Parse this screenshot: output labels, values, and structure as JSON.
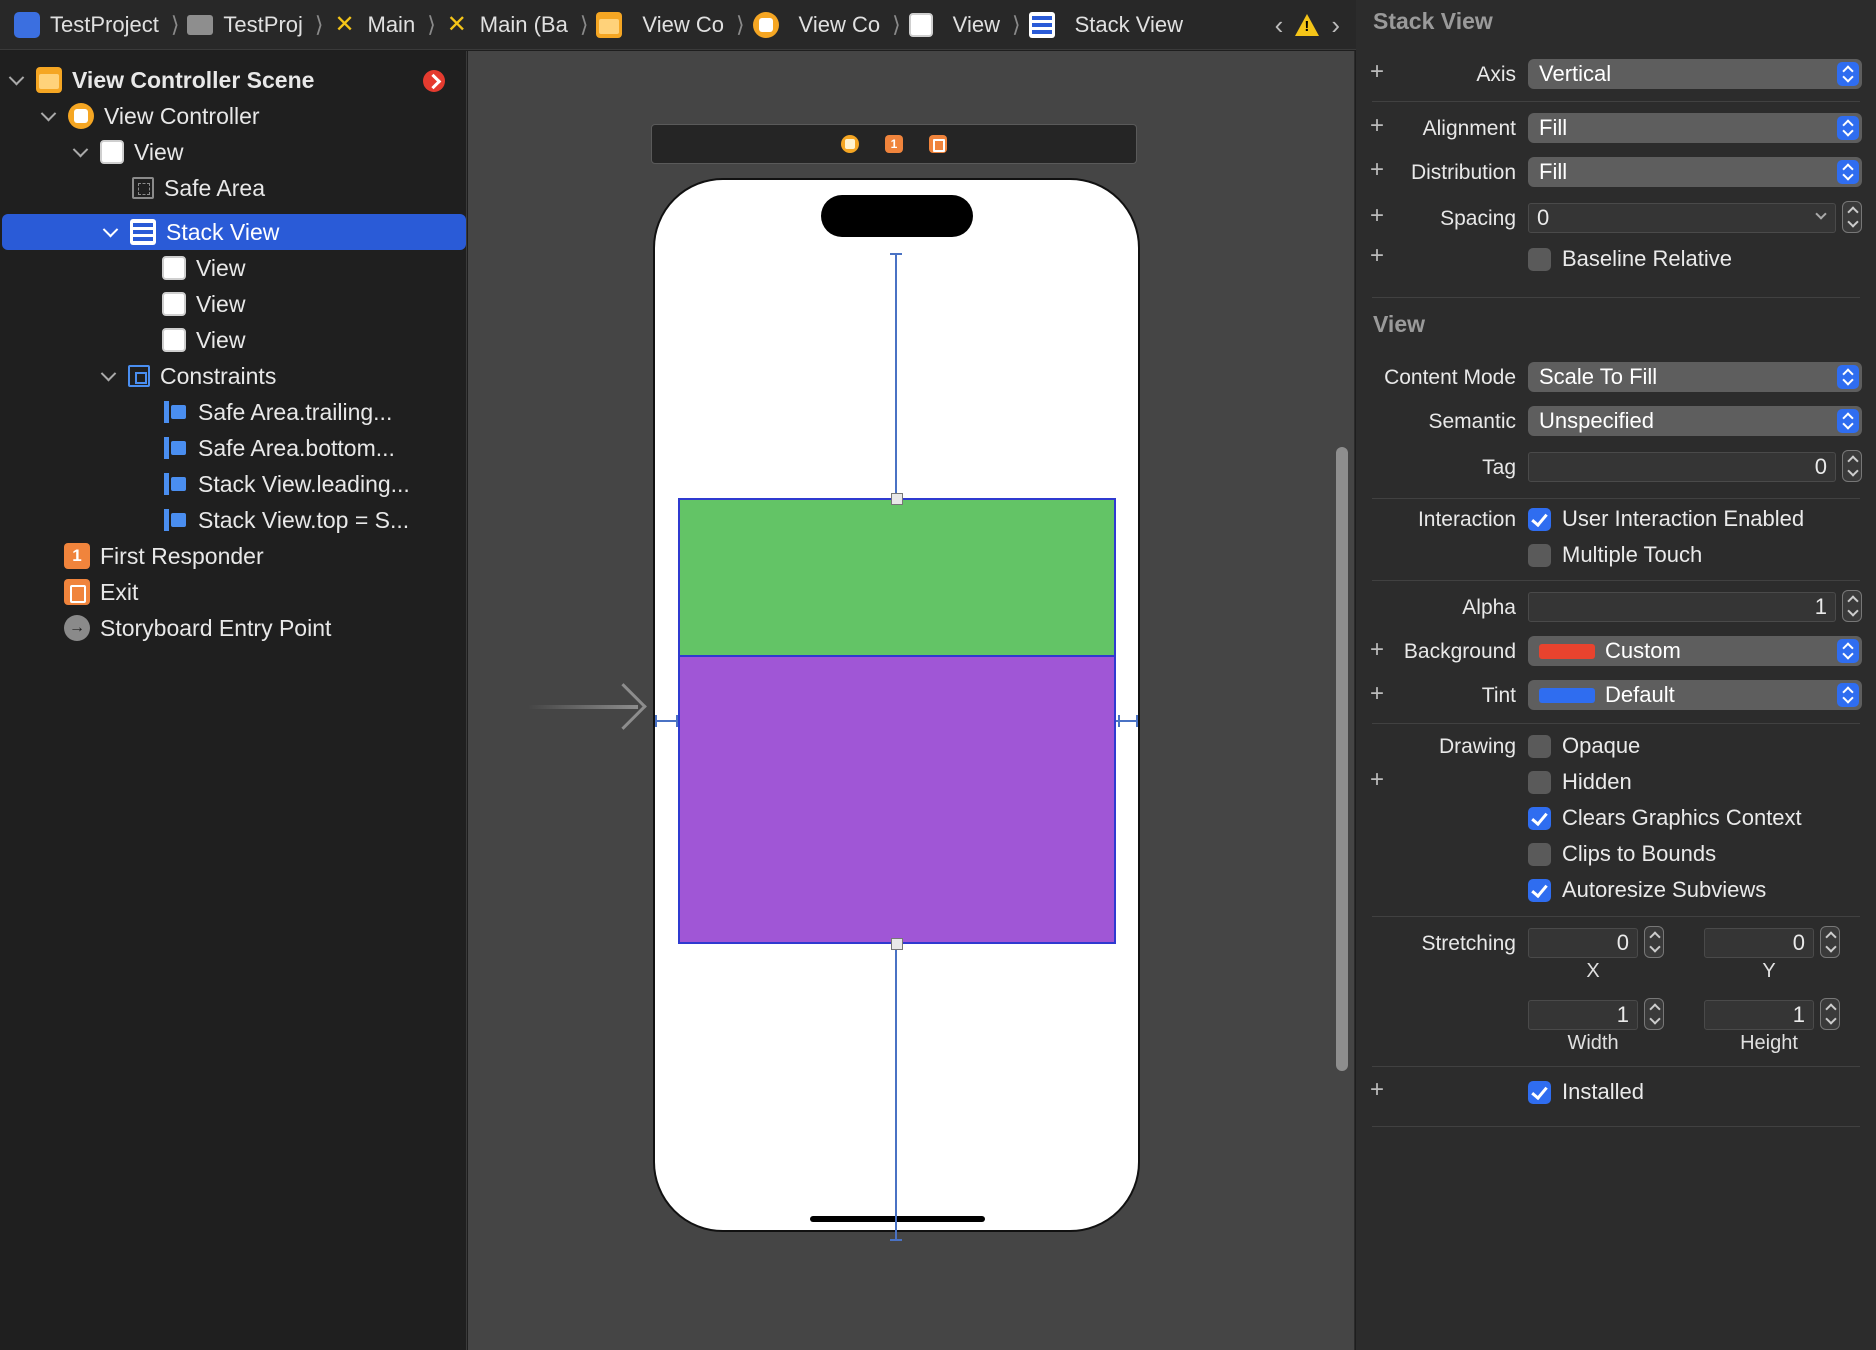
{
  "breadcrumb": [
    {
      "label": "TestProject",
      "icon": "app-project-icon",
      "color": "#3b6fe0"
    },
    {
      "label": "TestProj",
      "icon": "folder-icon",
      "color": "#9a9a9a"
    },
    {
      "label": "Main",
      "icon": "storyboard-icon",
      "color": "#f5c518"
    },
    {
      "label": "Main (Ba",
      "icon": "storyboard-icon",
      "color": "#f5c518"
    },
    {
      "label": "View Co",
      "icon": "scene-icon",
      "color": "#f5a623"
    },
    {
      "label": "View Co",
      "icon": "view-controller-icon",
      "color": "#f5a623"
    },
    {
      "label": "View",
      "icon": "view-icon",
      "color": "#ffffff"
    },
    {
      "label": "Stack View",
      "icon": "stack-view-icon",
      "color": "#ffffff"
    }
  ],
  "outline": {
    "items": [
      {
        "label": "View Controller Scene",
        "icon": "scene-icon",
        "depth": 0,
        "expanded": true,
        "bold": true
      },
      {
        "label": "View Controller",
        "icon": "view-controller-icon",
        "depth": 1,
        "expanded": true
      },
      {
        "label": "View",
        "icon": "view-icon",
        "depth": 2,
        "expanded": true
      },
      {
        "label": "Safe Area",
        "icon": "safe-area-icon",
        "depth": 3
      },
      {
        "label": "Stack View",
        "icon": "stack-view-icon",
        "depth": 3,
        "expanded": true,
        "selected": true
      },
      {
        "label": "View",
        "icon": "view-icon",
        "depth": 4
      },
      {
        "label": "View",
        "icon": "view-icon",
        "depth": 4
      },
      {
        "label": "View",
        "icon": "view-icon",
        "depth": 4
      },
      {
        "label": "Constraints",
        "icon": "constraints-icon",
        "depth": 3,
        "expanded": true
      },
      {
        "label": "Safe Area.trailing...",
        "icon": "constraint-icon",
        "depth": 4
      },
      {
        "label": "Safe Area.bottom...",
        "icon": "constraint-icon",
        "depth": 4
      },
      {
        "label": "Stack View.leading...",
        "icon": "constraint-icon",
        "depth": 4
      },
      {
        "label": "Stack View.top = S...",
        "icon": "constraint-icon",
        "depth": 4
      },
      {
        "label": "First Responder",
        "icon": "first-responder-icon",
        "depth": 1
      },
      {
        "label": "Exit",
        "icon": "exit-icon",
        "depth": 1
      },
      {
        "label": "Storyboard Entry Point",
        "icon": "entry-point-icon",
        "depth": 1
      }
    ],
    "responder_glyph": "1"
  },
  "canvas": {
    "first_responder_glyph": "1",
    "stack_colors": {
      "top": "#63c466",
      "bottom": "#a056d6"
    }
  },
  "inspector": {
    "stack_view": {
      "title": "Stack View",
      "axis_label": "Axis",
      "axis_value": "Vertical",
      "alignment_label": "Alignment",
      "alignment_value": "Fill",
      "distribution_label": "Distribution",
      "distribution_value": "Fill",
      "spacing_label": "Spacing",
      "spacing_value": "0",
      "baseline_relative": {
        "label": "Baseline Relative",
        "checked": false
      }
    },
    "view": {
      "title": "View",
      "content_mode_label": "Content Mode",
      "content_mode_value": "Scale To Fill",
      "semantic_label": "Semantic",
      "semantic_value": "Unspecified",
      "tag_label": "Tag",
      "tag_value": "0",
      "interaction_label": "Interaction",
      "user_interaction": {
        "label": "User Interaction Enabled",
        "checked": true
      },
      "multiple_touch": {
        "label": "Multiple Touch",
        "checked": false
      },
      "alpha_label": "Alpha",
      "alpha_value": "1",
      "background_label": "Background",
      "background_value": "Custom",
      "background_color": "#e8432e",
      "tint_label": "Tint",
      "tint_value": "Default",
      "tint_color": "#2f6df0",
      "drawing_label": "Drawing",
      "opaque": {
        "label": "Opaque",
        "checked": false
      },
      "hidden": {
        "label": "Hidden",
        "checked": false
      },
      "clears_graphics": {
        "label": "Clears Graphics Context",
        "checked": true
      },
      "clips_to_bounds": {
        "label": "Clips to Bounds",
        "checked": false
      },
      "autoresize_subviews": {
        "label": "Autoresize Subviews",
        "checked": true
      },
      "stretching_label": "Stretching",
      "stretch_x": "0",
      "stretch_y": "0",
      "stretch_width": "1",
      "stretch_height": "1",
      "x_label": "X",
      "y_label": "Y",
      "width_label": "Width",
      "height_label": "Height",
      "installed": {
        "label": "Installed",
        "checked": true
      }
    }
  }
}
